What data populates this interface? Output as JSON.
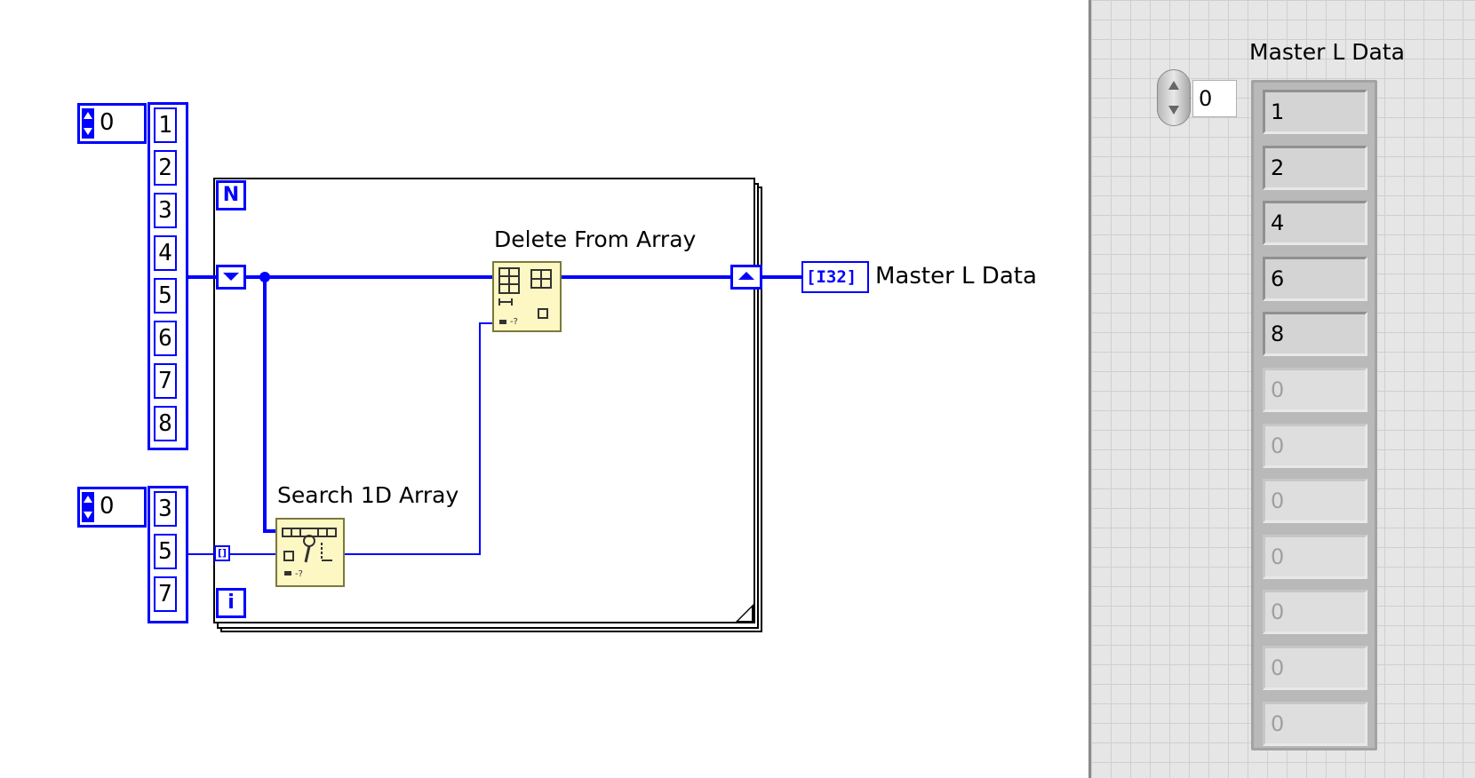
{
  "block_diagram": {
    "array_constant_1": {
      "index": "0",
      "values": [
        "1",
        "2",
        "3",
        "4",
        "5",
        "6",
        "7",
        "8"
      ]
    },
    "array_constant_2": {
      "index": "0",
      "values": [
        "3",
        "5",
        "7"
      ]
    },
    "for_loop": {
      "count_terminal": "N",
      "iteration_terminal": "i"
    },
    "nodes": {
      "search_label": "Search 1D Array",
      "delete_label": "Delete From Array"
    },
    "indicator": {
      "type_label": "[I32]",
      "name": "Master L Data"
    },
    "colors": {
      "wire": "#0000ff",
      "node_fill": "#fdf7c3"
    }
  },
  "front_panel": {
    "title": "Master L Data",
    "index": "0",
    "values": [
      "1",
      "2",
      "4",
      "6",
      "8"
    ],
    "empty_values": [
      "0",
      "0",
      "0",
      "0",
      "0",
      "0",
      "0"
    ]
  }
}
